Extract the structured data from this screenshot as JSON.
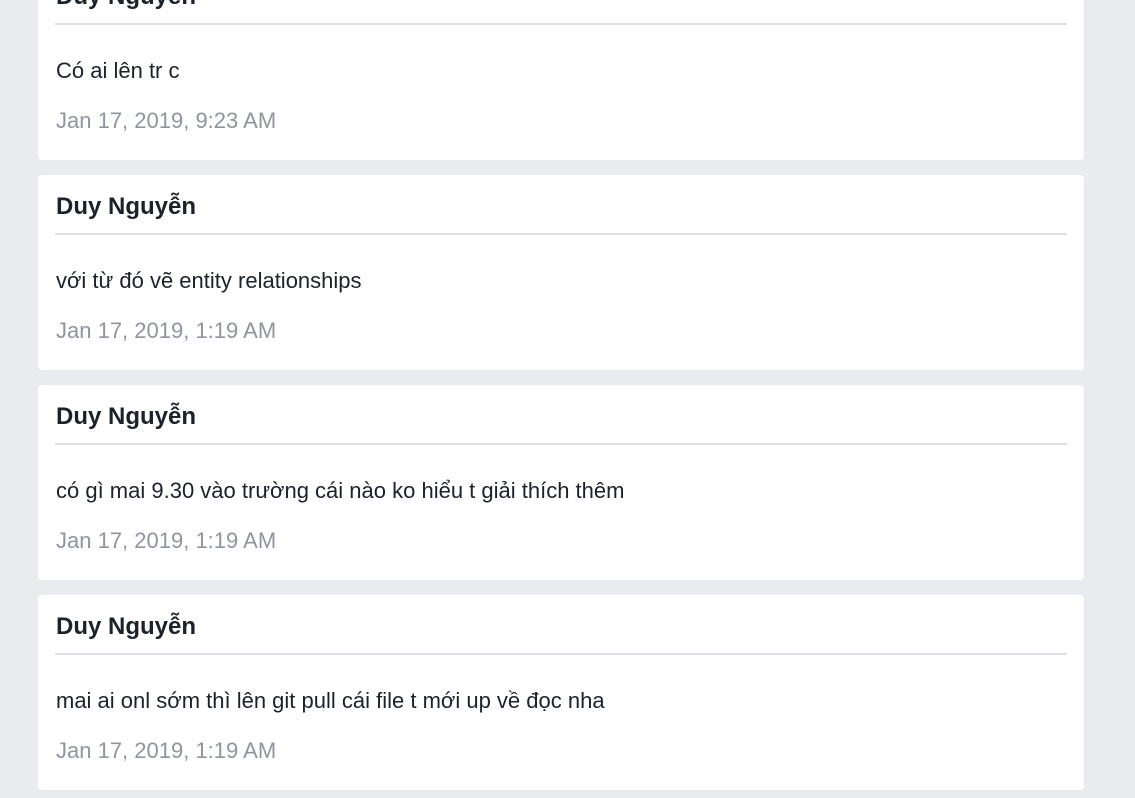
{
  "messages": [
    {
      "sender": "Duy Nguyễn",
      "text": "Có ai lên tr c",
      "timestamp": "Jan 17, 2019, 9:23 AM"
    },
    {
      "sender": "Duy Nguyễn",
      "text": "với từ đó vẽ entity relationships",
      "timestamp": "Jan 17, 2019, 1:19 AM"
    },
    {
      "sender": "Duy Nguyễn",
      "text": "có gì mai 9.30 vào trường cái nào ko hiểu t giải thích thêm",
      "timestamp": "Jan 17, 2019, 1:19 AM"
    },
    {
      "sender": "Duy Nguyễn",
      "text": "mai ai onl sớm thì lên git pull cái file t mới up về đọc nha",
      "timestamp": "Jan 17, 2019, 1:19 AM"
    }
  ]
}
